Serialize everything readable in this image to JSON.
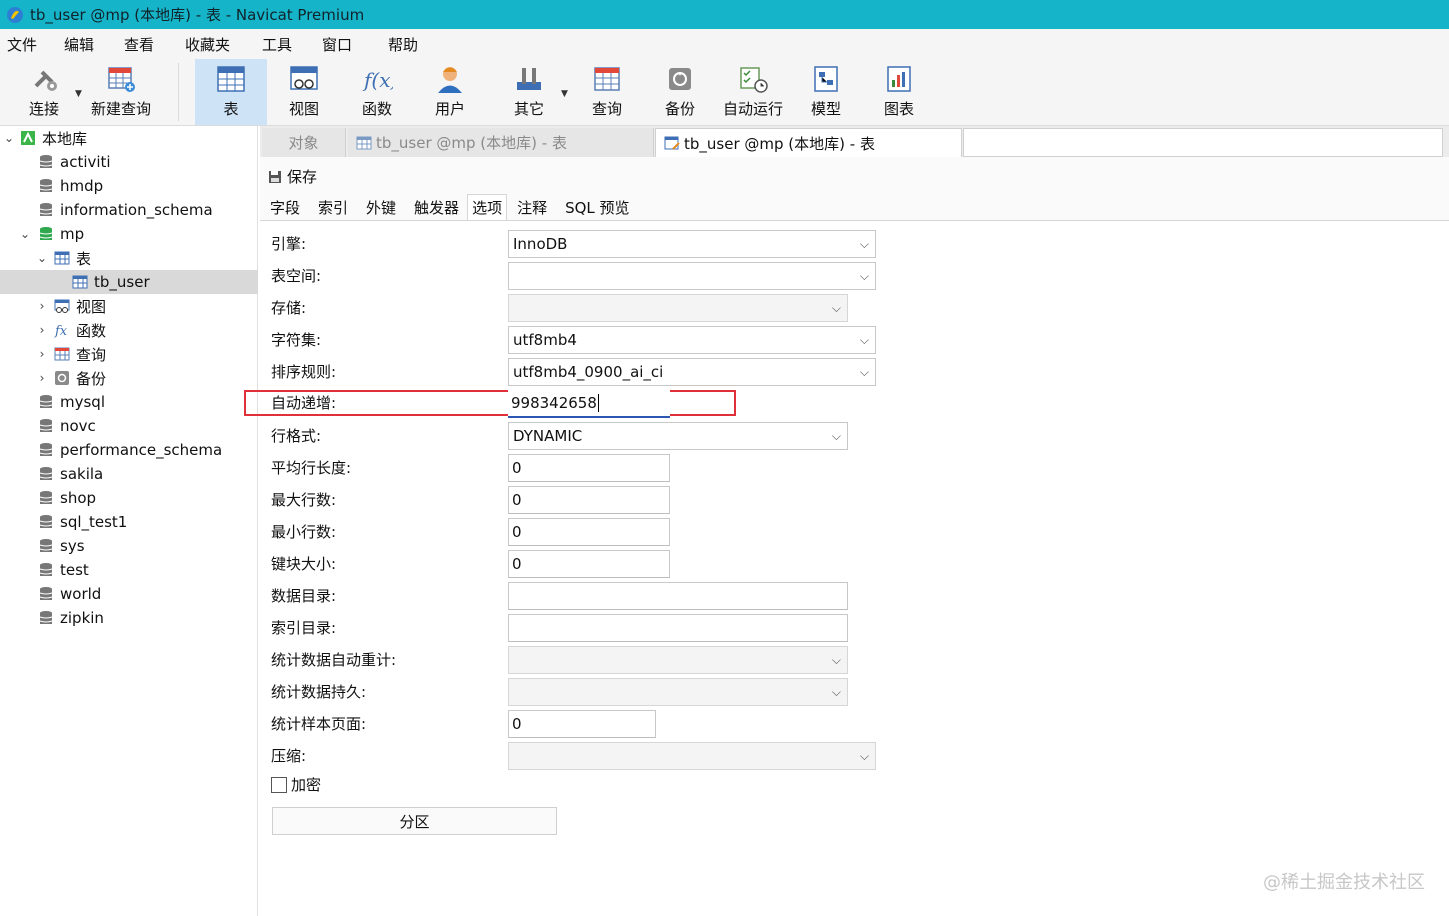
{
  "window": {
    "title": "tb_user @mp (本地库) - 表 - Navicat Premium"
  },
  "menu": [
    "文件",
    "编辑",
    "查看",
    "收藏夹",
    "工具",
    "窗口",
    "帮助"
  ],
  "toolbar": {
    "buttons": [
      {
        "label": "连接",
        "icon": "plug-icon"
      },
      {
        "label": "新建查询",
        "icon": "new-query-icon"
      },
      {
        "label": "表",
        "icon": "table-icon"
      },
      {
        "label": "视图",
        "icon": "view-icon"
      },
      {
        "label": "函数",
        "icon": "function-icon"
      },
      {
        "label": "用户",
        "icon": "user-icon"
      },
      {
        "label": "其它",
        "icon": "tools-icon"
      },
      {
        "label": "查询",
        "icon": "query-icon"
      },
      {
        "label": "备份",
        "icon": "backup-icon"
      },
      {
        "label": "自动运行",
        "icon": "automation-icon"
      },
      {
        "label": "模型",
        "icon": "model-icon"
      },
      {
        "label": "图表",
        "icon": "chart-icon"
      }
    ],
    "active": "表"
  },
  "sidebar": {
    "connection": "本地库",
    "databases_before": [
      "activiti",
      "hmdp",
      "information_schema"
    ],
    "open_db": "mp",
    "tables_group": "表",
    "selected_table": "tb_user",
    "mp_children": [
      "视图",
      "函数",
      "查询",
      "备份"
    ],
    "databases_after": [
      "mysql",
      "novc",
      "performance_schema",
      "sakila",
      "shop",
      "sql_test1",
      "sys",
      "test",
      "world",
      "zipkin"
    ]
  },
  "tabs": {
    "objects": "对象",
    "inactive_doc": "tb_user @mp (本地库) - 表",
    "active_doc": "tb_user @mp (本地库) - 表"
  },
  "save_label": "保存",
  "subtabs": [
    "字段",
    "索引",
    "外键",
    "触发器",
    "选项",
    "注释",
    "SQL 预览"
  ],
  "active_subtab": "选项",
  "options": {
    "engine": {
      "label": "引擎:",
      "value": "InnoDB"
    },
    "tablespace": {
      "label": "表空间:",
      "value": ""
    },
    "storage": {
      "label": "存储:",
      "value": ""
    },
    "charset": {
      "label": "字符集:",
      "value": "utf8mb4"
    },
    "collation": {
      "label": "排序规则:",
      "value": "utf8mb4_0900_ai_ci"
    },
    "auto_increment": {
      "label": "自动递增:",
      "value": "998342658"
    },
    "row_format": {
      "label": "行格式:",
      "value": "DYNAMIC"
    },
    "avg_row_length": {
      "label": "平均行长度:",
      "value": "0"
    },
    "max_rows": {
      "label": "最大行数:",
      "value": "0"
    },
    "min_rows": {
      "label": "最小行数:",
      "value": "0"
    },
    "key_block_size": {
      "label": "键块大小:",
      "value": "0"
    },
    "data_directory": {
      "label": "数据目录:",
      "value": ""
    },
    "index_directory": {
      "label": "索引目录:",
      "value": ""
    },
    "stats_auto_recalc": {
      "label": "统计数据自动重计:",
      "value": ""
    },
    "stats_persistent": {
      "label": "统计数据持久:",
      "value": ""
    },
    "stats_sample_pages": {
      "label": "统计样本页面:",
      "value": "0"
    },
    "compression": {
      "label": "压缩:",
      "value": ""
    },
    "encryption": {
      "label": "加密",
      "checked": false
    },
    "partition_button": "分区"
  },
  "watermark": "@稀土掘金技术社区",
  "colors": {
    "titlebar": "#16b4c8",
    "active_toolbar": "#cfe3f6",
    "highlight": "#e0303a",
    "focus_underline": "#2b57b3"
  }
}
